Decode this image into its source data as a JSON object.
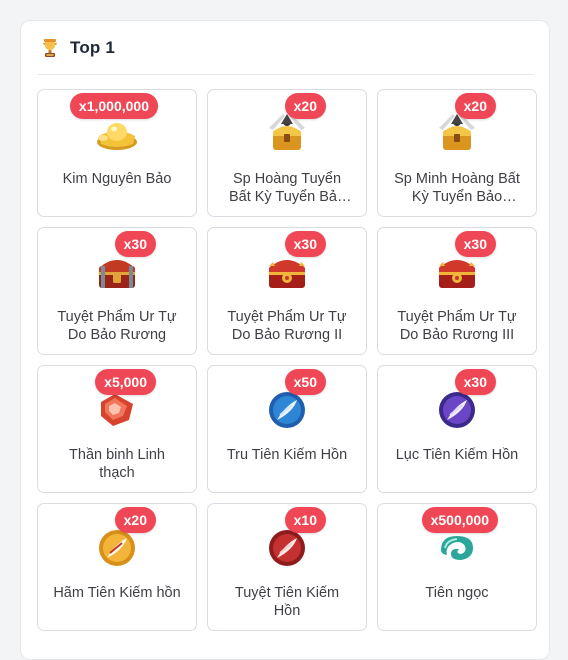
{
  "header": {
    "title": "Top 1",
    "icon": "trophy-icon"
  },
  "colors": {
    "badge": "#f04756",
    "card_border": "#d9dde3",
    "text": "#3f3f46"
  },
  "items": [
    {
      "name": "Kim Nguyên Bảo",
      "qty": "x1,000,000",
      "icon": "gold-ingot-icon"
    },
    {
      "name": "Sp Hoàng Tuyển Bất Kỳ Tuyển Bảo Rương",
      "qty": "x20",
      "icon": "gold-chest-icon"
    },
    {
      "name": "Sp Minh Hoàng Bất Kỳ Tuyển Bảo Rương",
      "qty": "x20",
      "icon": "gold-chest-icon"
    },
    {
      "name": "Tuyệt Phẩm Ur Tự Do Bảo Rương",
      "qty": "x30",
      "icon": "red-chest-icon"
    },
    {
      "name": "Tuyệt Phẩm Ur Tự Do Bảo Rương II",
      "qty": "x30",
      "icon": "red-chest-icon"
    },
    {
      "name": "Tuyệt Phẩm Ur Tự Do Bảo Rương III",
      "qty": "x30",
      "icon": "red-chest-icon"
    },
    {
      "name": "Thần binh Linh thạch",
      "qty": "x5,000",
      "icon": "red-crystal-icon"
    },
    {
      "name": "Tru Tiên Kiếm Hồn",
      "qty": "x50",
      "icon": "blue-sword-orb-icon"
    },
    {
      "name": "Lục Tiên Kiếm Hồn",
      "qty": "x30",
      "icon": "purple-sword-orb-icon"
    },
    {
      "name": "Hãm Tiên Kiếm hồn",
      "qty": "x20",
      "icon": "orange-sword-orb-icon"
    },
    {
      "name": "Tuyệt Tiên Kiếm Hồn",
      "qty": "x10",
      "icon": "red-sword-orb-icon"
    },
    {
      "name": "Tiên ngọc",
      "qty": "x500,000",
      "icon": "jade-icon"
    }
  ]
}
